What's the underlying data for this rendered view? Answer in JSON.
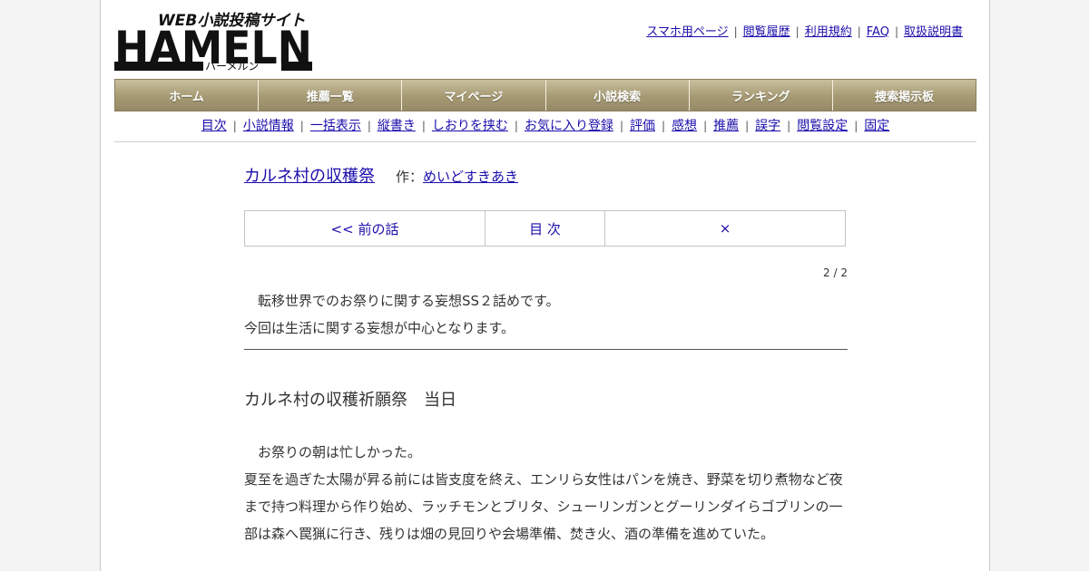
{
  "logo": {
    "tagline": "WEB小説投稿サイト",
    "wordmark": "HAMELN",
    "kana": "ハーメルン"
  },
  "top_links": [
    "スマホ用ページ",
    "閲覧履歴",
    "利用規約",
    "FAQ",
    "取扱説明書"
  ],
  "main_nav": [
    "ホーム",
    "推薦一覧",
    "マイページ",
    "小説検索",
    "ランキング",
    "捜索掲示板"
  ],
  "sub_nav": [
    "目次",
    "小説情報",
    "一括表示",
    "縦書き",
    "しおりを挟む",
    "お気に入り登録",
    "評価",
    "感想",
    "推薦",
    "誤字",
    "閲覧設定",
    "固定"
  ],
  "novel": {
    "title": "カルネ村の収穫祭",
    "author_label": "作：",
    "author": "めいどすきあき"
  },
  "pager": {
    "prev": "<< 前の話",
    "toc": "目 次",
    "close": "×"
  },
  "page_number": "2 / 2",
  "preface": [
    "　転移世界でのお祭りに関する妄想SS２話めです。",
    "今回は生活に関する妄想が中心となります。"
  ],
  "chapter_title": "カルネ村の収穫祈願祭　当日",
  "body": [
    "　お祭りの朝は忙しかった。",
    "夏至を過ぎた太陽が昇る前には皆支度を終え、エンリら女性はパンを焼き、野菜を切り煮物など夜",
    "まで持つ料理から作り始め、ラッチモンとブリタ、シューリンガンとグーリンダイらゴブリンの一",
    "部は森へ罠猟に行き、残りは畑の見回りや会場準備、焚き火、酒の準備を進めていた。"
  ]
}
